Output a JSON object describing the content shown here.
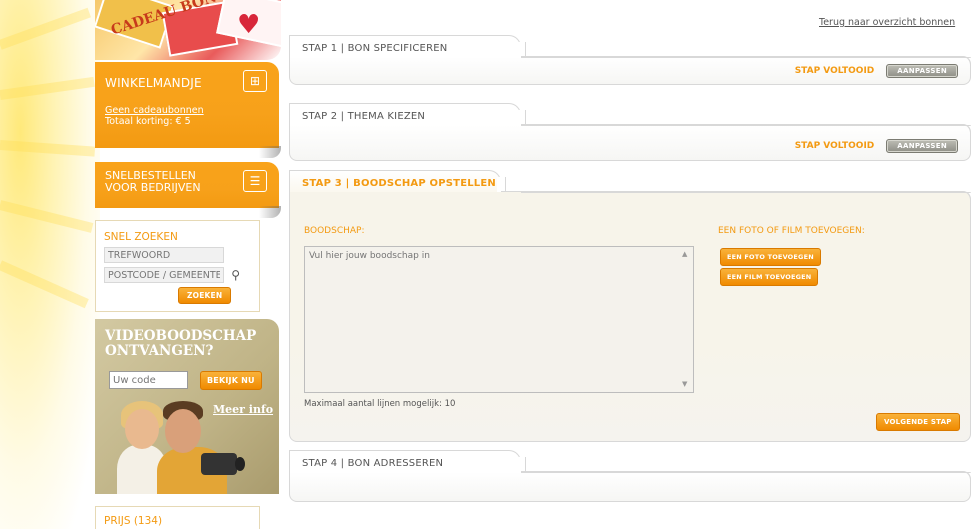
{
  "colors": {
    "accent": "#f39a12",
    "panel_border": "#d8d8d8",
    "gray_button": "#8f8f86",
    "sidebar_video_bg": "#bfb386"
  },
  "sidebar": {
    "promo_text": "CADEAU BON",
    "cart": {
      "title": "WINKELMANDJE",
      "link": "Geen cadeaubonnen",
      "discount": "Totaal korting: € 5",
      "icon": "cart-icon"
    },
    "quick_order": {
      "title_line1": "SNELBESTELLEN",
      "title_line2": "VOOR BEDRIJVEN",
      "icon": "document-icon"
    },
    "search": {
      "title": "SNEL ZOEKEN",
      "keyword_placeholder": "TREFWOORD",
      "postcode_placeholder": "POSTCODE / GEMEENTE",
      "button": "ZOEKEN",
      "icon": "magnifier-icon"
    },
    "video": {
      "title_line1": "VIDEOBOODSCHAP",
      "title_line2": "ONTVANGEN?",
      "code_placeholder": "Uw code",
      "button": "BEKIJK NU",
      "more_info": "Meer info"
    },
    "price": {
      "title": "PRIJS (134)"
    }
  },
  "main": {
    "back_link": "Terug naar overzicht bonnen",
    "steps": [
      {
        "title": "STAP 1 | BON SPECIFICEREN",
        "status": "STAP VOLTOOID",
        "button": "AANPASSEN"
      },
      {
        "title": "STAP 2 | THEMA KIEZEN",
        "status": "STAP VOLTOOID",
        "button": "AANPASSEN"
      },
      {
        "title": "STAP 3 | BOODSCHAP OPSTELLEN",
        "message_label": "BOODSCHAP:",
        "message_placeholder": "Vul hier jouw boodschap in",
        "max_lines": "Maximaal aantal lijnen mogelijk: 10",
        "media_label": "EEN FOTO OF FILM TOEVOEGEN:",
        "photo_button": "EEN FOTO TOEVOEGEN",
        "film_button": "EEN FILM TOEVOEGEN",
        "next_button": "VOLGENDE STAP"
      },
      {
        "title": "STAP 4 | BON ADRESSEREN"
      }
    ]
  }
}
